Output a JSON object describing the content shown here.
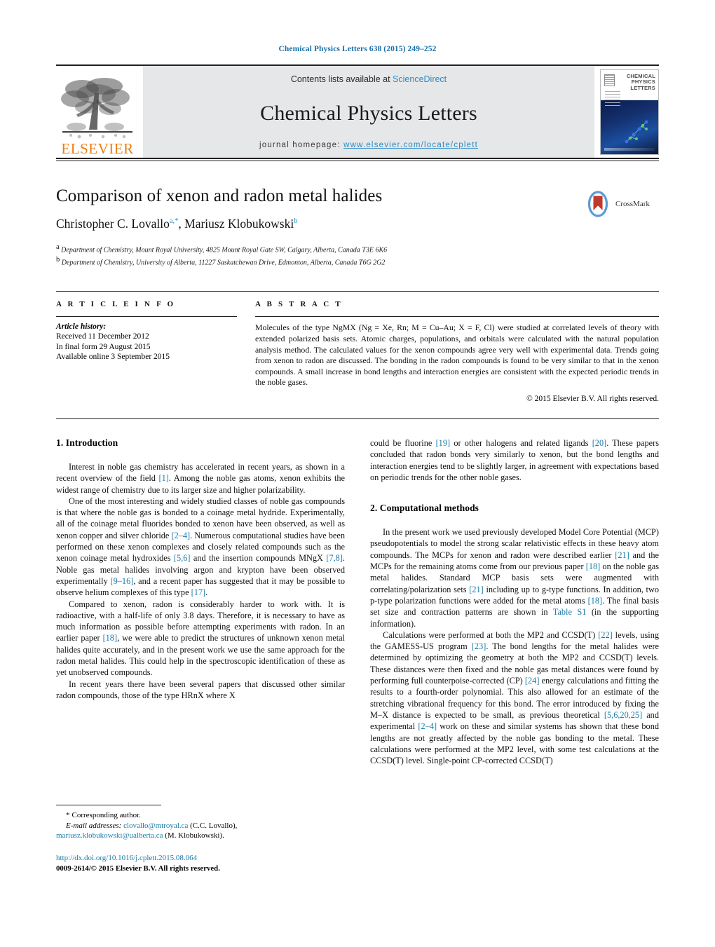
{
  "running_head": "Chemical Physics Letters 638 (2015) 249–252",
  "masthead": {
    "publisher_logo_text": "ELSEVIER",
    "contents_prefix": "Contents lists available at ",
    "contents_link": "ScienceDirect",
    "journal_title": "Chemical Physics Letters",
    "homepage_prefix": "journal homepage:",
    "homepage_url": "www.elsevier.com/locate/cplett",
    "cover": {
      "line1": "CHEMICAL",
      "line2": "PHYSICS",
      "line3": "LETTERS"
    }
  },
  "article": {
    "title": "Comparison of xenon and radon metal halides",
    "authors_plain": "Christopher C. Lovallo",
    "author1": "Christopher C. Lovallo",
    "author1_sup": "a,*",
    "author_sep": ", ",
    "author2": "Mariusz Klobukowski",
    "author2_sup": "b",
    "affiliation_a_mark": "a",
    "affiliation_a": "Department of Chemistry, Mount Royal University, 4825 Mount Royal Gate SW, Calgary, Alberta, Canada T3E 6K6",
    "affiliation_b_mark": "b",
    "affiliation_b": "Department of Chemistry, University of Alberta, 11227 Saskatchewan Drive, Edmonton, Alberta, Canada T6G 2G2",
    "crossmark_label": "CrossMark"
  },
  "info": {
    "heading": "A R T I C L E   I N F O",
    "history_label": "Article history:",
    "history": [
      "Received 11 December 2012",
      "In final form 29 August 2015",
      "Available online 3 September 2015"
    ]
  },
  "abstract": {
    "heading": "A B S T R A C T",
    "text": "Molecules of the type NgMX (Ng = Xe, Rn; M = Cu–Au; X = F, Cl) were studied at correlated levels of theory with extended polarized basis sets. Atomic charges, populations, and orbitals were calculated with the natural population analysis method. The calculated values for the xenon compounds agree very well with experimental data. Trends going from xenon to radon are discussed. The bonding in the radon compounds is found to be very similar to that in the xenon compounds. A small increase in bond lengths and interaction energies are consistent with the expected periodic trends in the noble gases.",
    "copyright": "© 2015 Elsevier B.V. All rights reserved."
  },
  "sections": {
    "intro_heading": "1.  Introduction",
    "intro_p1": "Interest in noble gas chemistry has accelerated in recent years, as shown in a recent overview of the field [1]. Among the noble gas atoms, xenon exhibits the widest range of chemistry due to its larger size and higher polarizability.",
    "intro_p2": "One of the most interesting and widely studied classes of noble gas compounds is that where the noble gas is bonded to a coinage metal hydride. Experimentally, all of the coinage metal fluorides bonded to xenon have been observed, as well as xenon copper and silver chloride [2–4]. Numerous computational studies have been performed on these xenon complexes and closely related compounds such as the xenon coinage metal hydroxides [5,6] and the insertion compounds MNgX [7,8]. Noble gas metal halides involving argon and krypton have been observed experimentally [9–16], and a recent paper has suggested that it may be possible to observe helium complexes of this type [17].",
    "intro_p3": "Compared to xenon, radon is considerably harder to work with. It is radioactive, with a half-life of only 3.8 days. Therefore, it is necessary to have as much information as possible before attempting experiments with radon. In an earlier paper [18], we were able to predict the structures of unknown xenon metal halides quite accurately, and in the present work we use the same approach for the radon metal halides. This could help in the spectroscopic identification of these as yet unobserved compounds.",
    "intro_p4": "In recent years there have been several papers that discussed other similar radon compounds, those of the type HRnX where X",
    "intro_p4_cont": "could be fluorine [19] or other halogens and related ligands [20]. These papers concluded that radon bonds very similarly to xenon, but the bond lengths and interaction energies tend to be slightly larger, in agreement with expectations based on periodic trends for the other noble gases.",
    "methods_heading": "2.  Computational methods",
    "methods_p1": "In the present work we used previously developed Model Core Potential (MCP) pseudopotentials to model the strong scalar relativistic effects in these heavy atom compounds. The MCPs for xenon and radon were described earlier [21] and the MCPs for the remaining atoms come from our previous paper [18] on the noble gas metal halides. Standard MCP basis sets were augmented with correlating/polarization sets [21] including up to g-type functions. In addition, two p-type polarization functions were added for the metal atoms [18]. The final basis set size and contraction patterns are shown in Table S1 (in the supporting information).",
    "methods_p2": "Calculations were performed at both the MP2 and CCSD(T) [22] levels, using the GAMESS-US program [23]. The bond lengths for the metal halides were determined by optimizing the geometry at both the MP2 and CCSD(T) levels. These distances were then fixed and the noble gas metal distances were found by performing full counterpoise-corrected (CP) [24] energy calculations and fitting the results to a fourth-order polynomial. This also allowed for an estimate of the stretching vibrational frequency for this bond. The error introduced by fixing the M–X distance is expected to be small, as previous theoretical [5,6,20,25] and experimental [2–4] work on these and similar systems has shown that these bond lengths are not greatly affected by the noble gas bonding to the metal. These calculations were performed at the MP2 level, with some test calculations at the CCSD(T) level. Single-point CP-corrected CCSD(T)"
  },
  "footer": {
    "corresponding_marker": "*",
    "corresponding_text": "Corresponding author.",
    "email_label": "E-mail addresses:",
    "email1": "clovallo@mtroyal.ca",
    "email1_owner": "(C.C. Lovallo)",
    "email2": "mariusz.klobukowski@ualberta.ca",
    "email2_owner": "(M. Klobukowski)",
    "doi": "http://dx.doi.org/10.1016/j.cplett.2015.08.064",
    "issn_line": "0009-2614/© 2015 Elsevier B.V. All rights reserved."
  },
  "colors": {
    "link_blue": "#1a7ba8",
    "header_blue": "#1a6ea8",
    "elsevier_orange": "#ee7d11",
    "masthead_grey": "#e6e7e9"
  }
}
